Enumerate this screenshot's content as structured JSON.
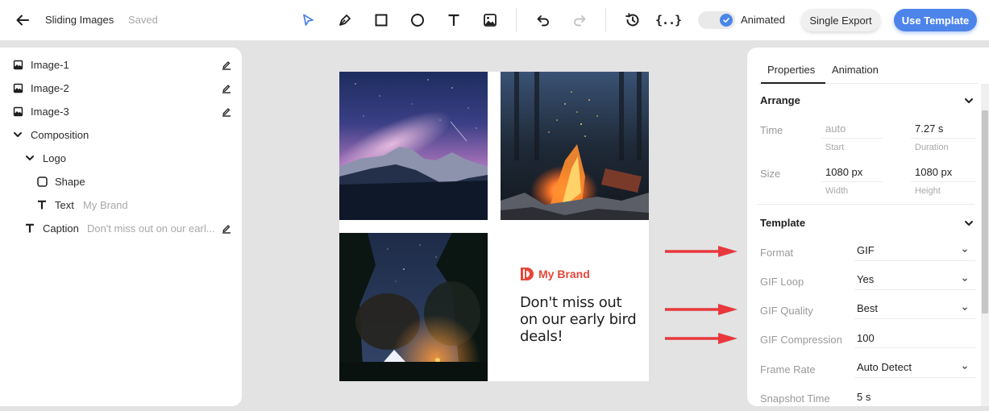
{
  "header": {
    "back_icon": "arrow-left-icon",
    "title": "Sliding Images",
    "status": "Saved",
    "tools": [
      {
        "name": "select-tool",
        "icon": "cursor-arrow-icon",
        "active": true
      },
      {
        "name": "pen-tool",
        "icon": "pen-icon"
      },
      {
        "name": "rectangle-tool",
        "icon": "square-icon"
      },
      {
        "name": "ellipse-tool",
        "icon": "circle-icon"
      },
      {
        "name": "text-tool",
        "icon": "text-icon"
      },
      {
        "name": "image-tool",
        "icon": "image-icon"
      },
      {
        "name": "undo",
        "icon": "undo-icon"
      },
      {
        "name": "redo",
        "icon": "redo-icon",
        "disabled": true
      },
      {
        "name": "history",
        "icon": "history-icon"
      },
      {
        "name": "variables",
        "icon": "braces-icon",
        "glyph": "{..}"
      }
    ],
    "animated_toggle": {
      "label": "Animated",
      "checked": true
    },
    "single_export_label": "Single Export",
    "use_template_label": "Use Template",
    "accent_color": "#4d84ea"
  },
  "layers": [
    {
      "type": "image",
      "label": "Image-1",
      "editable": true
    },
    {
      "type": "image",
      "label": "Image-2",
      "editable": true
    },
    {
      "type": "image",
      "label": "Image-3",
      "editable": true
    },
    {
      "type": "group",
      "label": "Composition",
      "expanded": true
    },
    {
      "type": "group",
      "label": "Logo",
      "expanded": true
    },
    {
      "type": "shape",
      "label": "Shape"
    },
    {
      "type": "text",
      "label": "Text",
      "sub": "My Brand"
    },
    {
      "type": "text",
      "label": "Caption",
      "sub": "Don't miss out on our earl...",
      "editable": true
    }
  ],
  "canvas": {
    "images": [
      {
        "name": "image-1",
        "description": "Milky way over snowy mountains"
      },
      {
        "name": "image-2",
        "description": "Campfire with sparks in forest"
      },
      {
        "name": "image-3",
        "description": "Tent under starry sky in forest"
      }
    ],
    "brand": {
      "name": "My Brand",
      "color": "#e5473a"
    },
    "caption": "Don't miss out on our early bird deals!"
  },
  "annotations": {
    "arrow_color": "#e8383d",
    "arrows_point_to": [
      "Format",
      "GIF Quality",
      "GIF Compression"
    ]
  },
  "properties": {
    "tabs": [
      {
        "label": "Properties",
        "active": true
      },
      {
        "label": "Animation",
        "active": false
      }
    ],
    "arrange": {
      "title": "Arrange",
      "time": {
        "label": "Time",
        "start": {
          "value": "auto",
          "caption": "Start"
        },
        "duration": {
          "value": "7.27 s",
          "caption": "Duration"
        }
      },
      "size": {
        "label": "Size",
        "width": {
          "value": "1080 px",
          "caption": "Width"
        },
        "height": {
          "value": "1080 px",
          "caption": "Height"
        }
      }
    },
    "template": {
      "title": "Template",
      "rows": [
        {
          "label": "Format",
          "value": "GIF",
          "type": "select"
        },
        {
          "label": "GIF Loop",
          "value": "Yes",
          "type": "select"
        },
        {
          "label": "GIF Quality",
          "value": "Best",
          "type": "select"
        },
        {
          "label": "GIF Compression",
          "value": "100",
          "type": "input"
        },
        {
          "label": "Frame Rate",
          "value": "Auto Detect",
          "type": "select"
        },
        {
          "label": "Snapshot Time",
          "value": "5 s",
          "type": "input"
        }
      ]
    }
  }
}
